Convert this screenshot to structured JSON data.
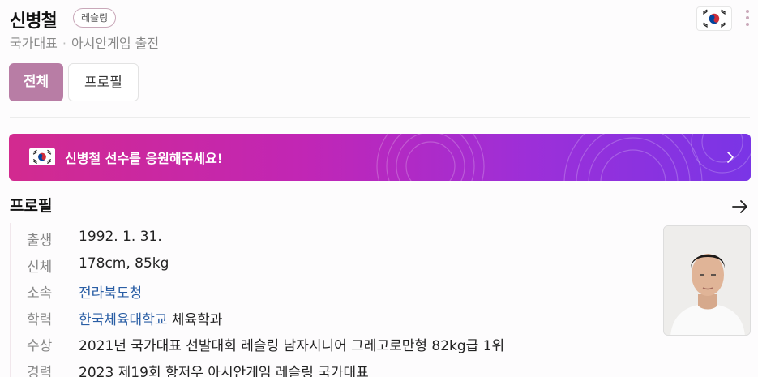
{
  "header": {
    "name": "신병철",
    "sport_badge": "레슬링",
    "subtitle_left": "국가대표",
    "subtitle_sep": "·",
    "subtitle_right": "아시안게임 출전",
    "flag_icon": "korea-flag-icon",
    "more_icon": "kebab-menu-icon"
  },
  "tabs": [
    {
      "label": "전체",
      "active": true
    },
    {
      "label": "프로필",
      "active": false
    }
  ],
  "banner": {
    "message": "신병철 선수를 응원해주세요!",
    "icon": "korea-flag-icon",
    "chevron": "chevron-right-icon"
  },
  "profile": {
    "title": "프로필",
    "arrow_icon": "arrow-right-icon",
    "rows": [
      {
        "label": "출생",
        "value": "1992. 1. 31."
      },
      {
        "label": "신체",
        "value": "178cm, 85kg"
      },
      {
        "label": "소속",
        "value": "전라북도청"
      },
      {
        "label": "학력",
        "link": "한국체육대학교",
        "value": " 체육학과"
      },
      {
        "label": "수상",
        "value": "2021년 국가대표 선발대회 레슬링 남자시니어 그레고로만형 82kg급 1위"
      },
      {
        "label": "경력",
        "value": "2023 제19회 항저우 아시안게임 레슬링 국가대표"
      }
    ]
  },
  "colors": {
    "accent": "#b87da5",
    "link": "#2a5ea5",
    "banner_start": "#d22a8f",
    "banner_end": "#7a35e6"
  }
}
